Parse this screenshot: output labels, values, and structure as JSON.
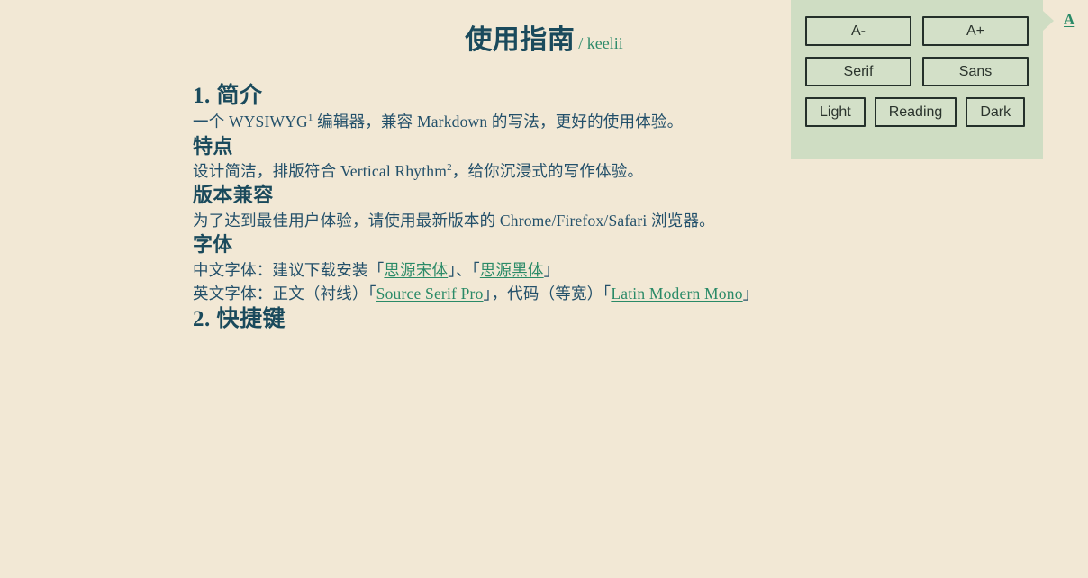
{
  "header": {
    "title": "使用指南",
    "byline": "/ keelii"
  },
  "settings_panel": {
    "font_size": {
      "decrease_label": "A-",
      "increase_label": "A+"
    },
    "typeface": {
      "serif_label": "Serif",
      "sans_label": "Sans"
    },
    "theme": {
      "light_label": "Light",
      "reading_label": "Reading",
      "dark_label": "Dark"
    },
    "toggle_label": "A",
    "panel_color": "#cfddc3",
    "button_color": "#d3e0c8",
    "button_border_color": "#24302a"
  },
  "document": {
    "sections": [
      {
        "level": 2,
        "heading": "1. 简介",
        "paragraph_prefix": "一个 WYSIWYG",
        "footnote": "1",
        "paragraph_suffix": " 编辑器，兼容 Markdown 的写法，更好的使用体验。"
      },
      {
        "level": 3,
        "heading": "特点",
        "paragraph_prefix": "设计简洁，排版符合 Vertical Rhythm",
        "footnote": "2",
        "paragraph_suffix": "，给你沉浸式的写作体验。"
      },
      {
        "level": 3,
        "heading": "版本兼容",
        "paragraph": "为了达到最佳用户体验，请使用最新版本的 Chrome/Firefox/Safari 浏览器。"
      },
      {
        "level": 3,
        "heading": "字体",
        "cn_font_line": {
          "prefix": "中文字体：建议下载安装",
          "open1": "「",
          "link1": "思源宋体",
          "close1": "」",
          "sep": "、",
          "open2": "「",
          "link2": "思源黑体",
          "close2": "」"
        },
        "en_font_line": {
          "prefix": "英文字体：正文（衬线）",
          "open1": "「",
          "link1": "Source Serif Pro",
          "close1": "」",
          "sep": "，代码（等宽）",
          "open2": "「",
          "link2": "Latin Modern Mono",
          "close2": "」"
        }
      },
      {
        "level": 2,
        "heading": "2. 快捷键"
      }
    ]
  },
  "colors": {
    "background": "#f2e8d5",
    "heading": "#1a4a5c",
    "body_text": "#23506a",
    "link": "#2a8a67",
    "accent_green": "#2f8b6b"
  }
}
